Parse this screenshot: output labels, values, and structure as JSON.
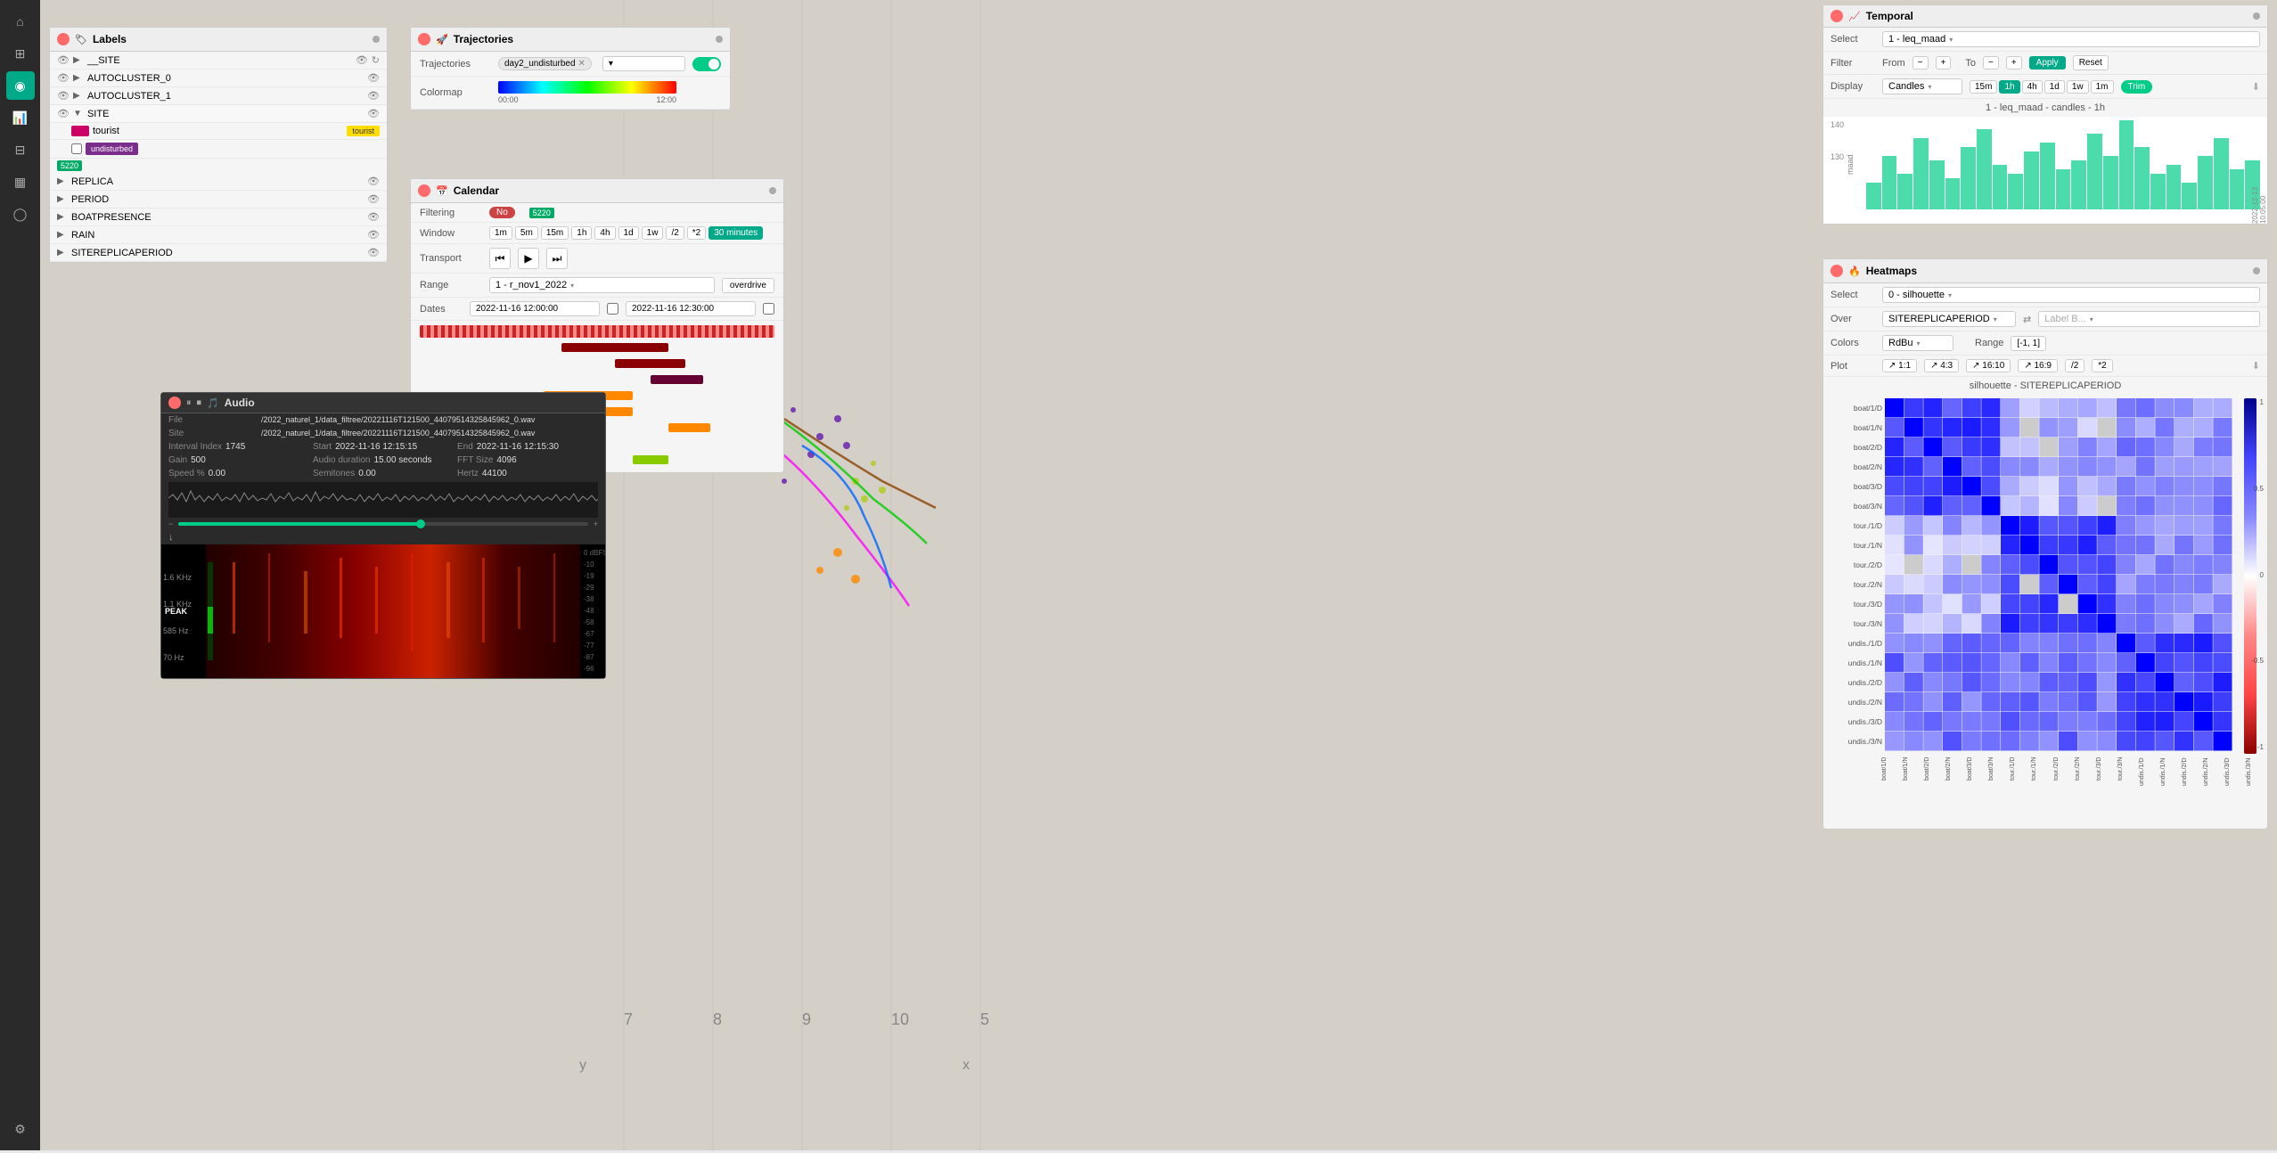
{
  "sidebar": {
    "icons": [
      "home",
      "layers",
      "map",
      "chart",
      "grid",
      "bar-chart",
      "circle",
      "settings"
    ]
  },
  "labels_panel": {
    "title": "Labels",
    "items": [
      {
        "name": "__SITE",
        "level": 1
      },
      {
        "name": "AUTOCLUSTER_0",
        "level": 1
      },
      {
        "name": "AUTOCLUSTER_1",
        "level": 1
      },
      {
        "name": "SITE",
        "level": 1,
        "expanded": true
      },
      {
        "name": "REPLICA",
        "level": 1
      },
      {
        "name": "PERIOD",
        "level": 1
      },
      {
        "name": "BOATPRESENCE",
        "level": 1
      },
      {
        "name": "RAIN",
        "level": 1
      },
      {
        "name": "SITEREPLICAPERIOD",
        "level": 1
      }
    ],
    "site_children": [
      {
        "name": "tourist",
        "color": "#ffdd00"
      },
      {
        "name": "undisturbed",
        "color": "#7b2d8b"
      }
    ],
    "green_label": "5220"
  },
  "trajectories": {
    "title": "Trajectories",
    "label_trajectories": "Trajectories",
    "label_colormap": "Colormap",
    "selected_traj": "day2_undisturbed",
    "colormap_from": "00:00",
    "colormap_to": "12:00"
  },
  "calendar": {
    "title": "Calendar",
    "label_filtering": "Filtering",
    "label_window": "Window",
    "label_transport": "Transport",
    "label_range": "Range",
    "label_dates": "Dates",
    "filtering_state": "No",
    "window_buttons": [
      "1m",
      "5m",
      "15m",
      "1h",
      "4h",
      "1d",
      "1w",
      "/2",
      "*2",
      "30 minutes"
    ],
    "range_value": "1 - r_nov1_2022",
    "date_from": "2022-11-16 12:00:00",
    "date_to": "2022-11-16 12:30:00",
    "overdrive": "overdrive"
  },
  "audio": {
    "title": "Audio",
    "file": "/2022_naturel_1/data_filtree/20221116T121500_44079514325845962_0.wav",
    "site": "/2022_naturel_1/data_filtree/20221116T121500_44079514325845962_0.wav",
    "interval_index": "1745",
    "start": "2022-11-16 12:15:15",
    "end": "2022-11-16 12:15:30",
    "gain": "500",
    "audio_duration": "15.00 seconds",
    "fft_size": "4096",
    "speed_pct": "0.00",
    "semitones": "0.00",
    "hertz": "44100",
    "freq_labels": [
      "1.6 KHz",
      "1.1 KHz",
      "585 Hz",
      "70 Hz"
    ],
    "db_labels": [
      "0 dBFS",
      "-10",
      "-19",
      "-29",
      "-38",
      "-48",
      "-58",
      "-67",
      "-77",
      "-87",
      "-96"
    ]
  },
  "temporal": {
    "title": "Temporal",
    "label_select": "Select",
    "label_filter": "Filter",
    "label_display": "Display",
    "select_value": "1 - leq_maad",
    "filter_from": "From",
    "filter_to": "To",
    "filter_plus": "+",
    "filter_minus": "-",
    "apply": "Apply",
    "reset": "Reset",
    "display_value": "Candles",
    "time_buttons": [
      "15m",
      "1h",
      "4h",
      "1d",
      "1w",
      "1m"
    ],
    "active_time": "1h",
    "chart_title": "1 - leq_maad - candles - 1h",
    "y_label": "maad",
    "y_values": [
      "140",
      "130"
    ],
    "trim": "Trim"
  },
  "heatmaps": {
    "title": "Heatmaps",
    "label_select": "Select",
    "label_over": "Over",
    "label_colors": "Colors",
    "label_range": "Range",
    "label_plot": "Plot",
    "select_value": "0 - silhouette",
    "over_value": "SITEREPLICAPERIOD",
    "colors_value": "RdBu",
    "range_value": "[-1, 1]",
    "plot_options": [
      "↗ 1:1",
      "↗ 4:3",
      "↗ 16:10",
      "↗ 16:9",
      "/2",
      "*2"
    ],
    "chart_title": "silhouette - SITEREPLICAPERIOD",
    "y_labels": [
      "boat/1/D",
      "boat/1/N",
      "boat/2/D",
      "boat/2/N",
      "boat/3/D",
      "boat/3/N",
      "tour./1/D",
      "tour./1/N",
      "tour./2/D",
      "tour./2/N",
      "tour./3/D",
      "tour./3/N",
      "undis./1/D",
      "undis./1/N",
      "undis./2/D",
      "undis./2/N",
      "undis./3/D",
      "undis./3/N"
    ],
    "x_labels": [
      "boat/1/D",
      "boat/1/N",
      "boat/2/D",
      "boat/2/N",
      "boat/3/D",
      "boat/3/N",
      "tour./1/D",
      "tour./1/N",
      "tour./2/D",
      "tour./2/N",
      "tour./3/D",
      "tour./3/N",
      "undis./1/D",
      "undis./1/N",
      "undis./2/D",
      "undis./2/N",
      "undis./3/D",
      "undis./3/N"
    ],
    "colorbar_values": [
      "1",
      "0.5",
      "0",
      "-0.5",
      "-1"
    ],
    "label_b": "Label B..."
  }
}
